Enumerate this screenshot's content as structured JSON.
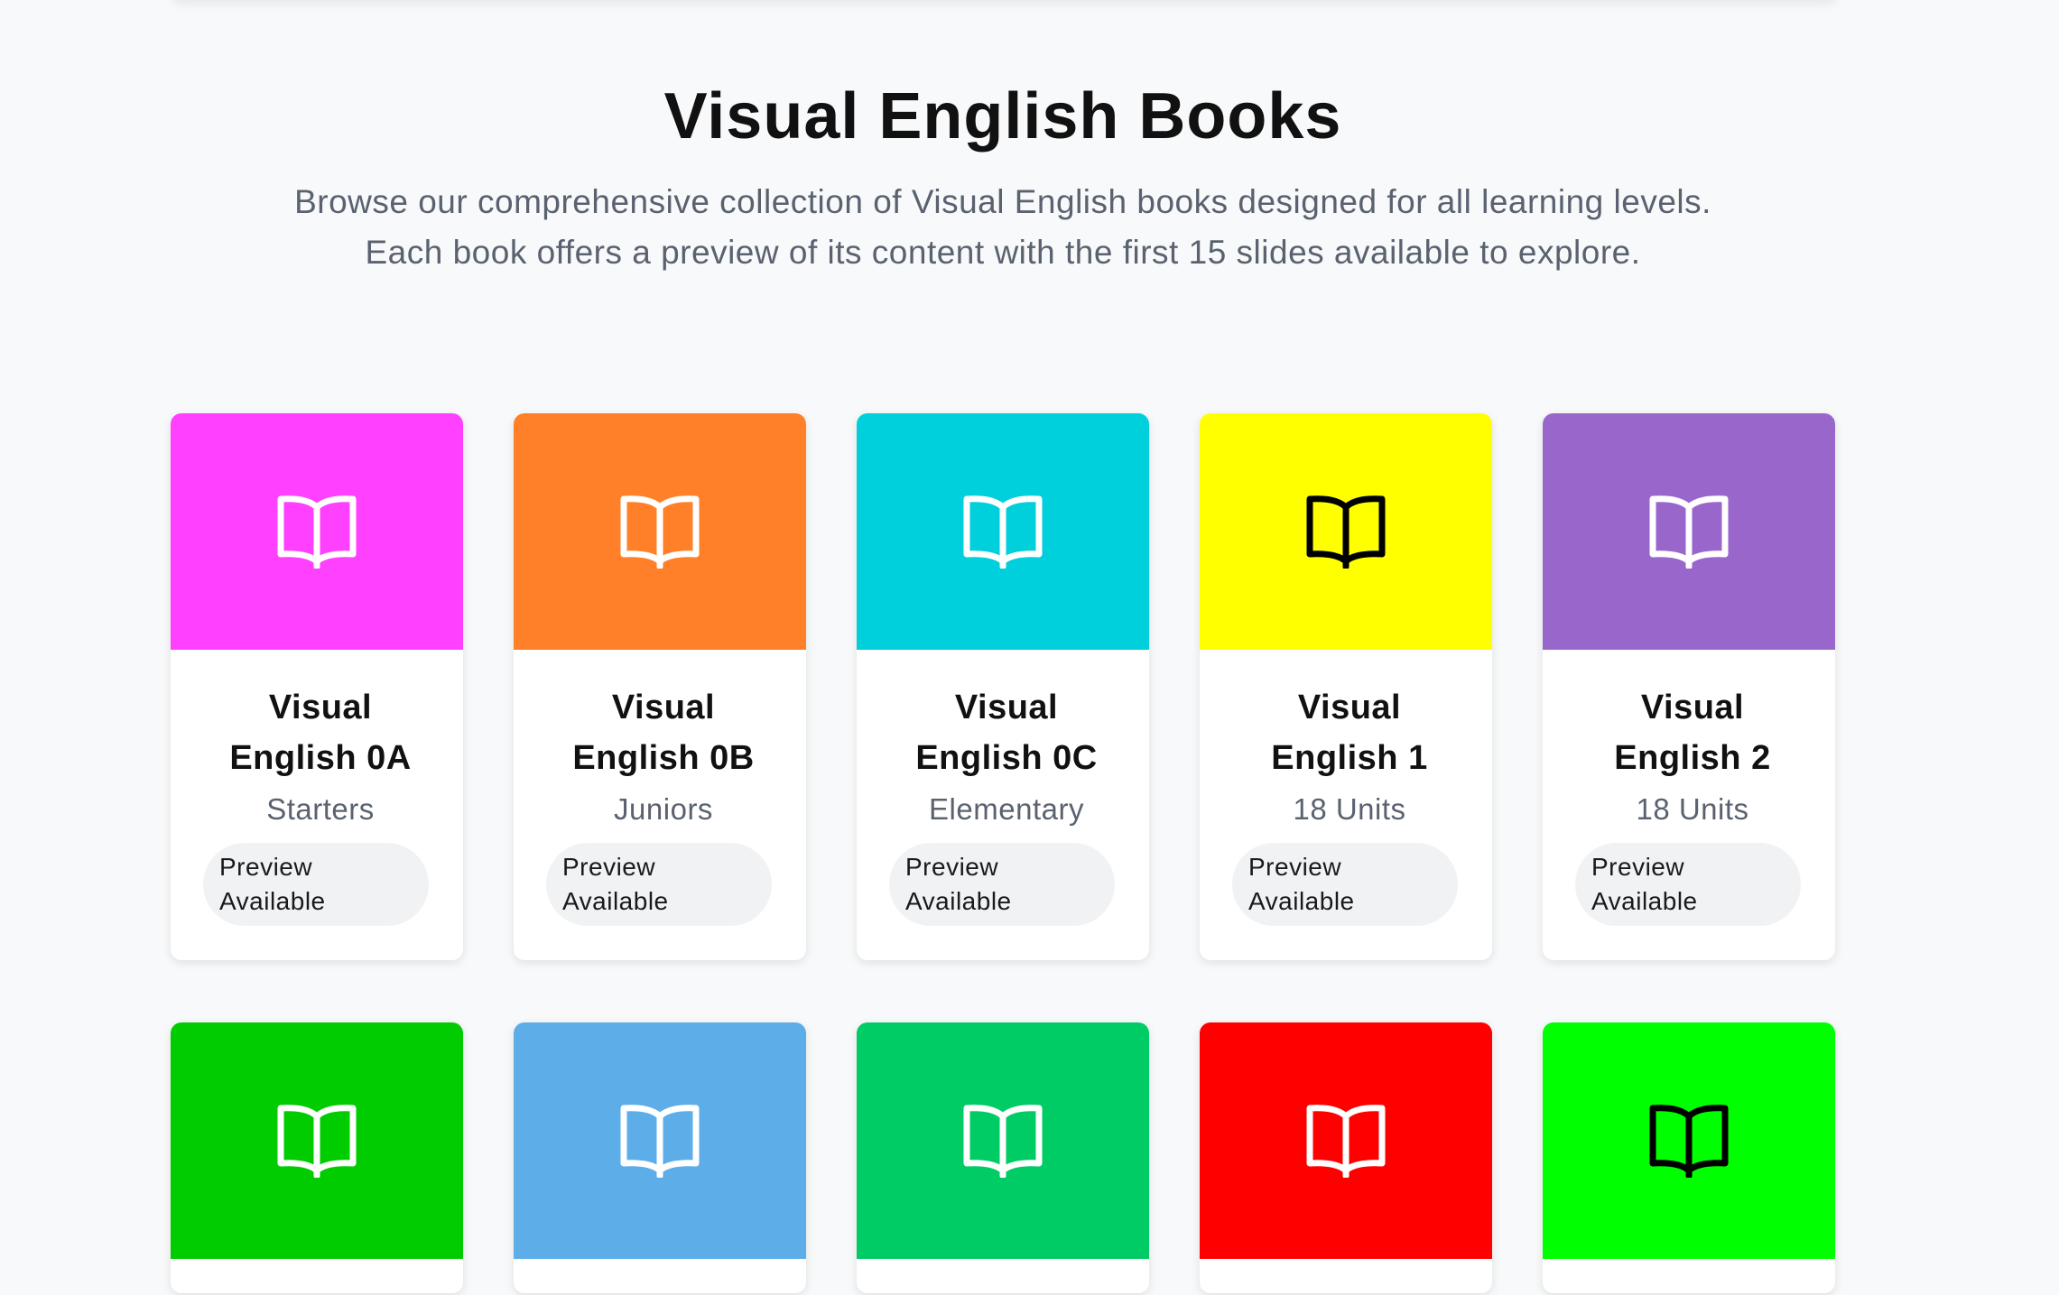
{
  "header": {
    "title": "Visual English Books",
    "description": "Browse our comprehensive collection of Visual English books designed for all learning levels. Each book offers a preview of its content with the first 15 slides available to explore."
  },
  "books": [
    {
      "title": "Visual English 0A",
      "level": "Starters",
      "badge": "Preview Available",
      "color": "#ff40ff",
      "icon": "open-book-icon",
      "icon_color": "#ffffff"
    },
    {
      "title": "Visual English 0B",
      "level": "Juniors",
      "badge": "Preview Available",
      "color": "#ff8028",
      "icon": "open-book-icon",
      "icon_color": "#ffffff"
    },
    {
      "title": "Visual English 0C",
      "level": "Elementary",
      "badge": "Preview Available",
      "color": "#00cfdc",
      "icon": "open-book-icon",
      "icon_color": "#ffffff"
    },
    {
      "title": "Visual English 1",
      "level": "18 Units",
      "badge": "Preview Available",
      "color": "#ffff00",
      "icon": "open-book-icon",
      "icon_color": "#000000"
    },
    {
      "title": "Visual English 2",
      "level": "18 Units",
      "badge": "Preview Available",
      "color": "#9966cc",
      "icon": "open-book-icon",
      "icon_color": "#ffffff"
    }
  ],
  "books_row2": [
    {
      "color": "#00cc00",
      "icon": "open-book-icon",
      "icon_color": "#ffffff"
    },
    {
      "color": "#5dade9",
      "icon": "open-book-icon",
      "icon_color": "#ffffff"
    },
    {
      "color": "#00cc66",
      "icon": "open-book-icon",
      "icon_color": "#ffffff"
    },
    {
      "color": "#ff0000",
      "icon": "open-book-icon",
      "icon_color": "#ffffff"
    },
    {
      "color": "#00ff00",
      "icon": "open-book-icon",
      "icon_color": "#000000"
    }
  ]
}
